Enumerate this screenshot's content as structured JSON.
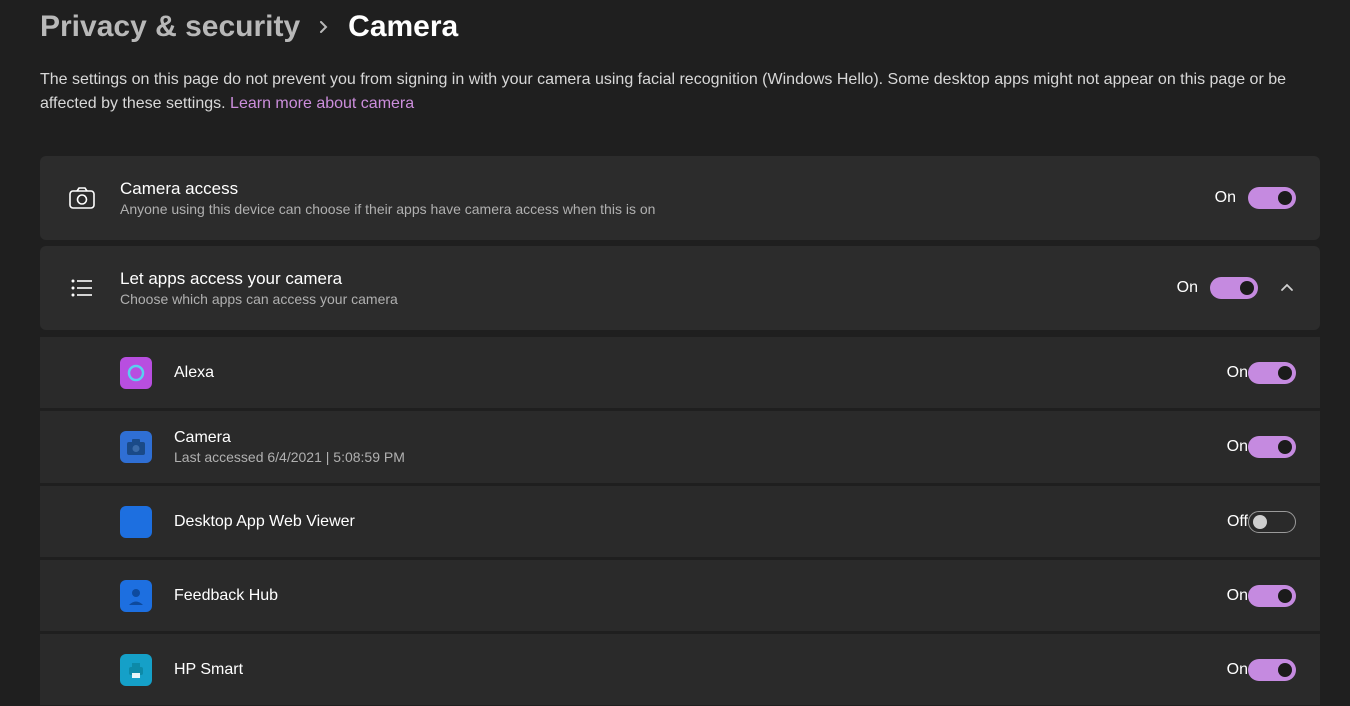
{
  "breadcrumb": {
    "parent": "Privacy & security",
    "current": "Camera"
  },
  "intro": {
    "text": "The settings on this page do not prevent you from signing in with your camera using facial recognition (Windows Hello). Some desktop apps might not appear on this page or be affected by these settings.  ",
    "link": "Learn more about camera"
  },
  "camera_access": {
    "title": "Camera access",
    "subtitle": "Anyone using this device can choose if their apps have camera access when this is on",
    "state": "On",
    "on": true
  },
  "apps_access": {
    "title": "Let apps access your camera",
    "subtitle": "Choose which apps can access your camera",
    "state": "On",
    "on": true,
    "expanded": true
  },
  "apps": [
    {
      "name": "Alexa",
      "sub": "",
      "state": "On",
      "on": true,
      "icon_bg": "#b84ee0",
      "icon_glyph": "circle"
    },
    {
      "name": "Camera",
      "sub": "Last accessed 6/4/2021  |  5:08:59 PM",
      "state": "On",
      "on": true,
      "icon_bg": "#2f6fd4",
      "icon_glyph": "camera"
    },
    {
      "name": "Desktop App Web Viewer",
      "sub": "",
      "state": "Off",
      "on": false,
      "icon_bg": "#1d6fe0",
      "icon_glyph": "square"
    },
    {
      "name": "Feedback Hub",
      "sub": "",
      "state": "On",
      "on": true,
      "icon_bg": "#1d6fe0",
      "icon_glyph": "person"
    },
    {
      "name": "HP Smart",
      "sub": "",
      "state": "On",
      "on": true,
      "icon_bg": "#15a0c8",
      "icon_glyph": "printer"
    }
  ]
}
